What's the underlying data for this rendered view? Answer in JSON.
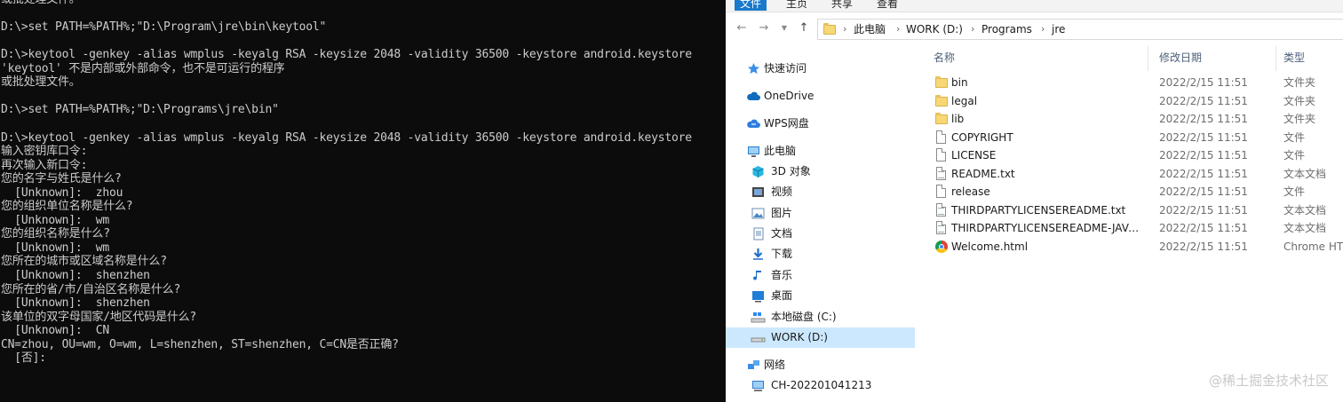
{
  "terminal": {
    "lines": [
      "或批处理文件。",
      "",
      "D:\\>set PATH=%PATH%;\"D:\\Program\\jre\\bin\\keytool\"",
      "",
      "D:\\>keytool -genkey -alias wmplus -keyalg RSA -keysize 2048 -validity 36500 -keystore android.keystore",
      "'keytool' 不是内部或外部命令，也不是可运行的程序",
      "或批处理文件。",
      "",
      "D:\\>set PATH=%PATH%;\"D:\\Programs\\jre\\bin\"",
      "",
      "D:\\>keytool -genkey -alias wmplus -keyalg RSA -keysize 2048 -validity 36500 -keystore android.keystore",
      "输入密钥库口令:",
      "再次输入新口令:",
      "您的名字与姓氏是什么?",
      "  [Unknown]:  zhou",
      "您的组织单位名称是什么?",
      "  [Unknown]:  wm",
      "您的组织名称是什么?",
      "  [Unknown]:  wm",
      "您所在的城市或区域名称是什么?",
      "  [Unknown]:  shenzhen",
      "您所在的省/市/自治区名称是什么?",
      "  [Unknown]:  shenzhen",
      "该单位的双字母国家/地区代码是什么?",
      "  [Unknown]:  CN",
      "CN=zhou, OU=wm, O=wm, L=shenzhen, ST=shenzhen, C=CN是否正确?",
      "  [否]:"
    ]
  },
  "explorer": {
    "ribbon": {
      "tabs": [
        "文件",
        "主页",
        "共享",
        "查看"
      ]
    },
    "breadcrumb": [
      "此电脑",
      "WORK (D:)",
      "Programs",
      "jre"
    ],
    "nav_items": [
      {
        "label": "快速访问",
        "icon": "star-icon"
      },
      {
        "label": "OneDrive",
        "icon": "cloud-icon"
      },
      {
        "label": "WPS网盘",
        "icon": "wps-cloud-icon"
      },
      {
        "label": "此电脑",
        "icon": "computer-icon"
      },
      {
        "label": "3D 对象",
        "icon": "3d-objects-icon"
      },
      {
        "label": "视频",
        "icon": "video-icon"
      },
      {
        "label": "图片",
        "icon": "pictures-icon"
      },
      {
        "label": "文档",
        "icon": "documents-icon"
      },
      {
        "label": "下载",
        "icon": "download-icon"
      },
      {
        "label": "音乐",
        "icon": "music-icon"
      },
      {
        "label": "桌面",
        "icon": "desktop-icon"
      },
      {
        "label": "本地磁盘 (C:)",
        "icon": "drive-c-icon"
      },
      {
        "label": "WORK (D:)",
        "icon": "drive-d-icon",
        "selected": true
      },
      {
        "label": "网络",
        "icon": "network-icon"
      },
      {
        "label": "CH-202201041213",
        "icon": "network-computer-icon"
      }
    ],
    "columns": {
      "name": "名称",
      "date": "修改日期",
      "type": "类型"
    },
    "files": [
      {
        "name": "bin",
        "date": "2022/2/15 11:51",
        "type": "文件夹",
        "icon": "folder-icon"
      },
      {
        "name": "legal",
        "date": "2022/2/15 11:51",
        "type": "文件夹",
        "icon": "folder-icon"
      },
      {
        "name": "lib",
        "date": "2022/2/15 11:51",
        "type": "文件夹",
        "icon": "folder-icon"
      },
      {
        "name": "COPYRIGHT",
        "date": "2022/2/15 11:51",
        "type": "文件",
        "icon": "file-icon"
      },
      {
        "name": "LICENSE",
        "date": "2022/2/15 11:51",
        "type": "文件",
        "icon": "file-icon"
      },
      {
        "name": "README.txt",
        "date": "2022/2/15 11:51",
        "type": "文本文档",
        "icon": "text-file-icon"
      },
      {
        "name": "release",
        "date": "2022/2/15 11:51",
        "type": "文件",
        "icon": "file-icon"
      },
      {
        "name": "THIRDPARTYLICENSEREADME.txt",
        "date": "2022/2/15 11:51",
        "type": "文本文档",
        "icon": "text-file-icon"
      },
      {
        "name": "THIRDPARTYLICENSEREADME-JAVAF...",
        "date": "2022/2/15 11:51",
        "type": "文本文档",
        "icon": "text-file-icon"
      },
      {
        "name": "Welcome.html",
        "date": "2022/2/15 11:51",
        "type": "Chrome HTM",
        "icon": "chrome-icon"
      }
    ]
  },
  "watermark": "@稀土掘金技术社区",
  "colors": {
    "terminal_bg": "#0c0c0c",
    "terminal_text": "#cccccc",
    "ribbon_active": "#1979ca",
    "selected_row": "#cce8ff"
  }
}
